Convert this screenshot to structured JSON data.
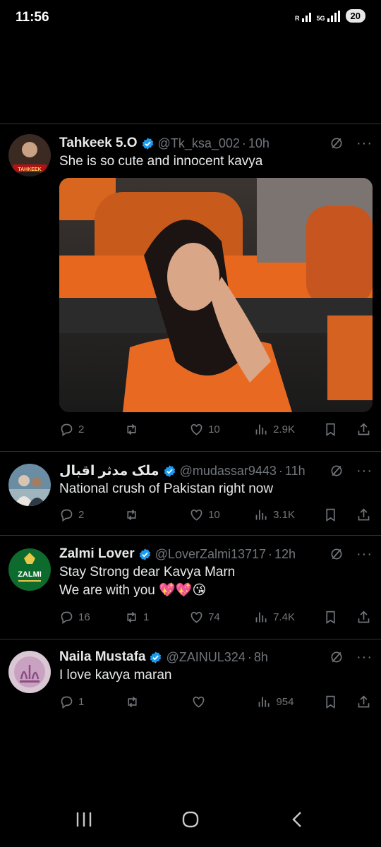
{
  "status": {
    "time": "11:56",
    "network": "5G",
    "battery": "20"
  },
  "tweets": [
    {
      "name": "Tahkeek 5.O",
      "handle": "@Tk_ksa_002",
      "time": "10h",
      "text": "She is so cute and innocent kavya",
      "avatar_text": "TAHKEEK",
      "stats": {
        "replies": "2",
        "retweets": "",
        "likes": "10",
        "views": "2.9K"
      }
    },
    {
      "name": "ملک مدثر اقبال",
      "handle": "@mudassar9443",
      "time": "11h",
      "text": "National crush of Pakistan right now",
      "stats": {
        "replies": "2",
        "retweets": "",
        "likes": "10",
        "views": "3.1K"
      }
    },
    {
      "name": "Zalmi Lover",
      "handle": "@LoverZalmi13717",
      "time": "12h",
      "text_line1": "Stay Strong dear Kavya Marn",
      "text_line2": "We are with you 💖💖😘",
      "avatar_text": "ZALMI",
      "stats": {
        "replies": "16",
        "retweets": "1",
        "likes": "74",
        "views": "7.4K"
      }
    },
    {
      "name": "Naila Mustafa",
      "handle": "@ZAINUL324",
      "time": "8h",
      "text": "I love kavya maran",
      "stats": {
        "replies": "1",
        "retweets": "",
        "likes": "",
        "views": "954"
      }
    }
  ],
  "colors": {
    "accent": "#1d9bf0",
    "muted": "#71767b",
    "text": "#e7e9ea"
  }
}
